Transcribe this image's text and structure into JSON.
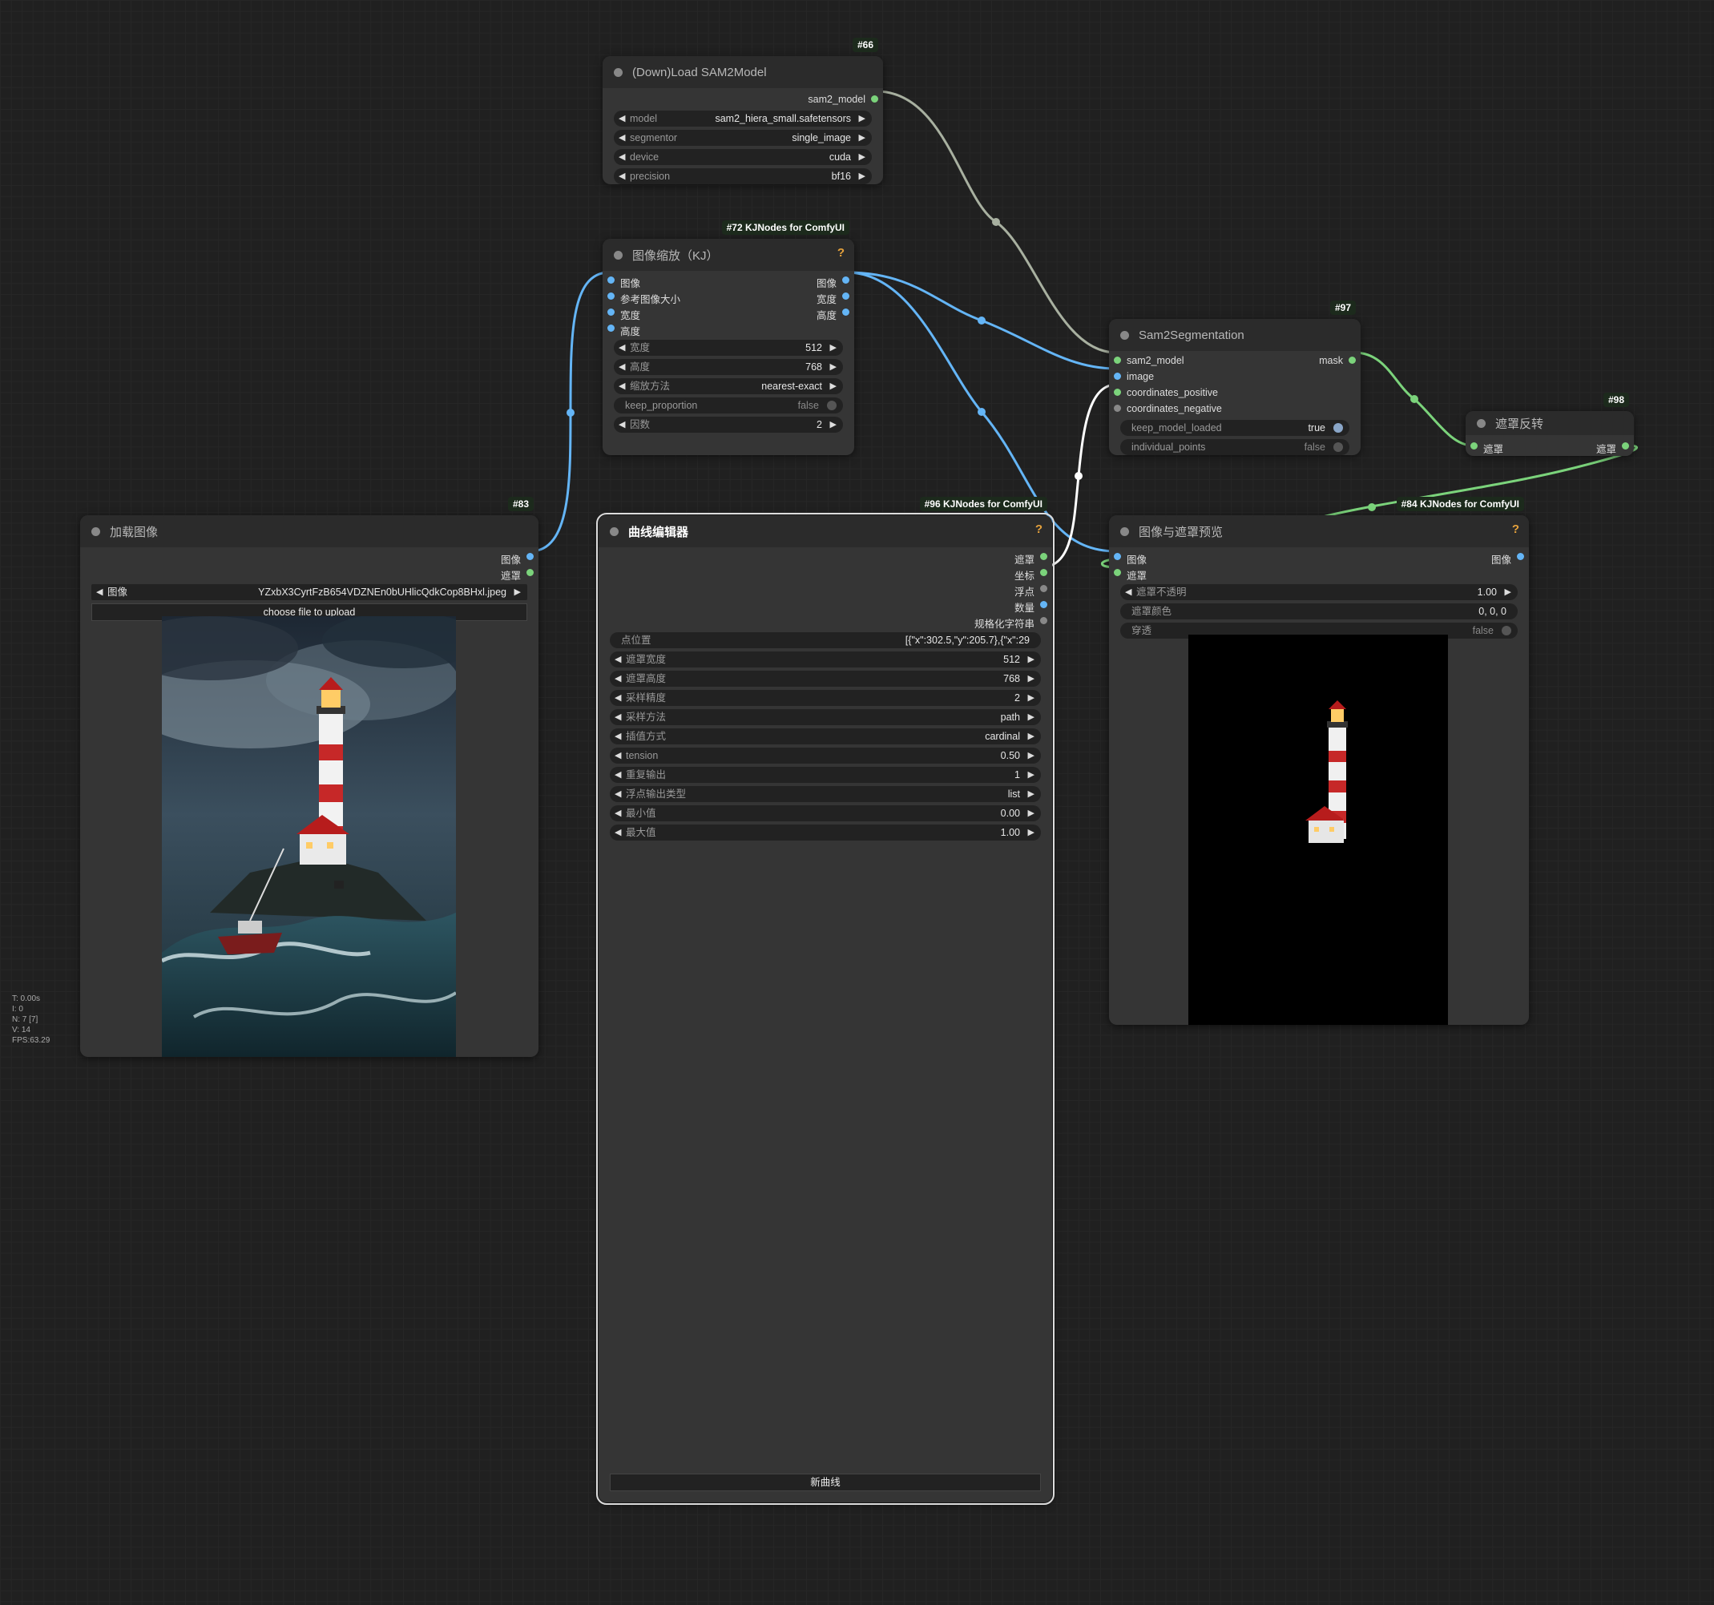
{
  "nodes": {
    "load_sam2": {
      "badge": "#66",
      "title": "(Down)Load SAM2Model",
      "output": "sam2_model",
      "widgets": [
        {
          "label": "model",
          "value": "sam2_hiera_small.safetensors"
        },
        {
          "label": "segmentor",
          "value": "single_image"
        },
        {
          "label": "device",
          "value": "cuda"
        },
        {
          "label": "precision",
          "value": "bf16"
        }
      ]
    },
    "resize": {
      "badge": "#72 KJNodes for ComfyUI",
      "title": "图像缩放（KJ）",
      "inputs": [
        "图像",
        "参考图像大小",
        "宽度",
        "高度"
      ],
      "outputs": [
        "图像",
        "宽度",
        "高度"
      ],
      "widgets": [
        {
          "label": "宽度",
          "value": "512"
        },
        {
          "label": "高度",
          "value": "768"
        },
        {
          "label": "缩放方法",
          "value": "nearest-exact"
        },
        {
          "label": "keep_proportion",
          "value": "false"
        },
        {
          "label": "因数",
          "value": "2"
        }
      ]
    },
    "sam2seg": {
      "badge": "#97",
      "title": "Sam2Segmentation",
      "inputs": [
        "sam2_model",
        "image",
        "coordinates_positive",
        "coordinates_negative"
      ],
      "output": "mask",
      "widgets": [
        {
          "label": "keep_model_loaded",
          "value": "true"
        },
        {
          "label": "individual_points",
          "value": "false"
        }
      ]
    },
    "invert": {
      "badge": "#98",
      "title": "遮罩反转",
      "input": "遮罩",
      "output": "遮罩"
    },
    "load_image": {
      "badge": "#83",
      "title": "加载图像",
      "outputs": [
        "图像",
        "遮罩"
      ],
      "image_label": "图像",
      "image_value": "YZxbX3CyrtFzB654VDZNEn0bUHlicQdkCop8BHxl.jpeg",
      "upload_label": "choose file to upload"
    },
    "curve": {
      "badge": "#96 KJNodes for ComfyUI",
      "title": "曲线编辑器",
      "outputs": [
        "遮罩",
        "坐标",
        "浮点",
        "数量",
        "规格化字符串"
      ],
      "points_label": "点位置",
      "points_value": "[{\"x\":302.5,\"y\":205.7},{\"x\":29",
      "widgets": [
        {
          "label": "遮罩宽度",
          "value": "512"
        },
        {
          "label": "遮罩高度",
          "value": "768"
        },
        {
          "label": "采样精度",
          "value": "2"
        },
        {
          "label": "采样方法",
          "value": "path"
        },
        {
          "label": "插值方式",
          "value": "cardinal"
        },
        {
          "label": "tension",
          "value": "0.50"
        },
        {
          "label": "重复输出",
          "value": "1"
        },
        {
          "label": "浮点输出类型",
          "value": "list"
        },
        {
          "label": "最小值",
          "value": "0.00"
        },
        {
          "label": "最大值",
          "value": "1.00"
        }
      ],
      "button": "新曲线"
    },
    "preview": {
      "badge": "#84 KJNodes for ComfyUI",
      "title": "图像与遮罩预览",
      "inputs": [
        "图像",
        "遮罩"
      ],
      "output": "图像",
      "widgets": [
        {
          "label": "遮罩不透明",
          "value": "1.00"
        },
        {
          "label": "遮罩颜色",
          "value": "0, 0, 0"
        },
        {
          "label": "穿透",
          "value": "false"
        }
      ]
    }
  },
  "stats": [
    "T: 0.00s",
    "I: 0",
    "N: 7 [7]",
    "V: 14",
    "FPS:63.29"
  ],
  "colors": {
    "image_link": "#64b5f6",
    "mask_link": "#7bd37b",
    "model_link": "#a8b0a0",
    "coords_link": "#ffffff"
  }
}
